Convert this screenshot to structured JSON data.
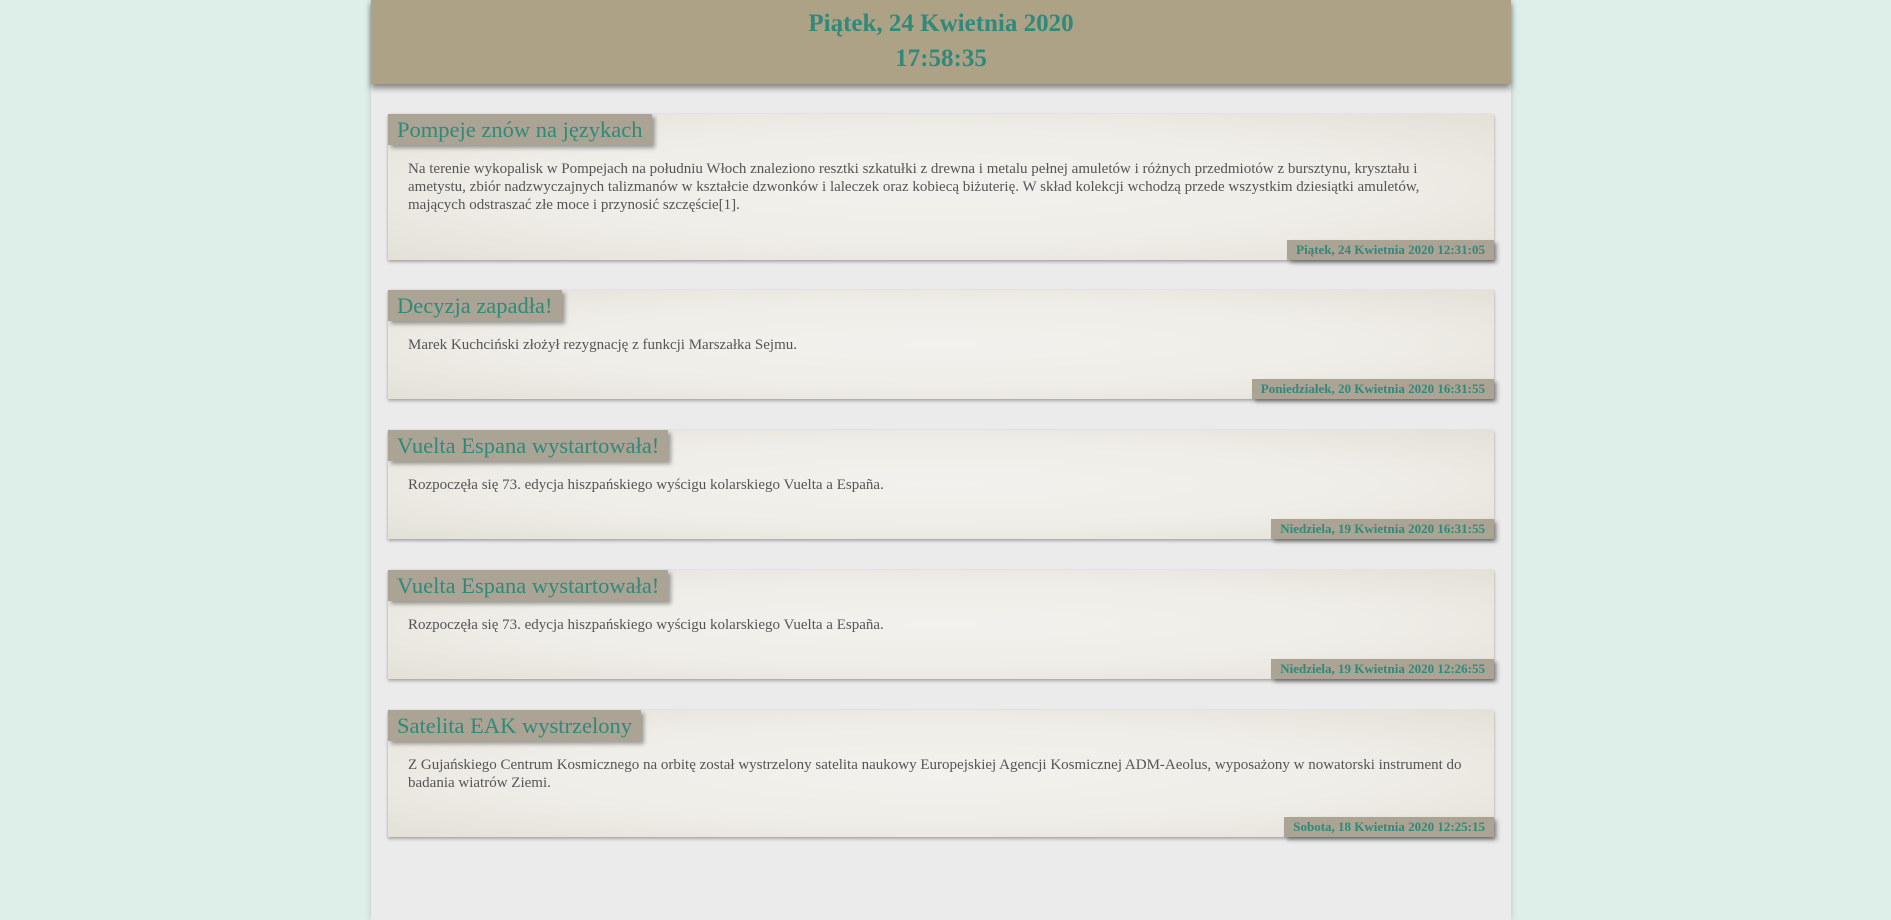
{
  "header": {
    "date": "Piątek, 24 Kwietnia 2020",
    "time": "17:58:35"
  },
  "news": [
    {
      "title": "Pompeje znów na językach",
      "body": "Na terenie wykopalisk w Pompejach na południu Włoch znaleziono resztki szkatułki z drewna i metalu pełnej amuletów i różnych przedmiotów z bursztynu, kryształu i ametystu, zbiór nadzwyczajnych talizmanów w kształcie dzwonków i laleczek oraz kobiecą biżuterię. W skład kolekcji wchodzą przede wszystkim dziesiątki amuletów, mających odstraszać złe moce i przynosić szczęście[1].",
      "date": "Piątek, 24 Kwietnia 2020 12:31:05"
    },
    {
      "title": "Decyzja zapadła!",
      "body": "Marek Kuchciński złożył rezygnację z funkcji Marszałka Sejmu.",
      "date": "Poniedziałek, 20 Kwietnia 2020 16:31:55"
    },
    {
      "title": "Vuelta Espana wystartowała!",
      "body": "Rozpoczęła się 73. edycja hiszpańskiego wyścigu kolarskiego Vuelta a España.",
      "date": "Niedziela, 19 Kwietnia 2020 16:31:55"
    },
    {
      "title": "Vuelta Espana wystartowała!",
      "body": "Rozpoczęła się 73. edycja hiszpańskiego wyścigu kolarskiego Vuelta a España.",
      "date": "Niedziela, 19 Kwietnia 2020 12:26:55"
    },
    {
      "title": "Satelita EAK wystrzelony",
      "body": "Z Gujańskiego Centrum Kosmicznego na orbitę został wystrzelony satelita naukowy Europejskiej Agencji Kosmicznej ADM-Aeolus, wyposażony w nowatorski instrument do badania wiatrów Ziemi.",
      "date": "Sobota, 18 Kwietnia 2020 12:25:15"
    }
  ],
  "colors": {
    "background": "#deefe9",
    "header": "#ada286",
    "accent_text": "#2f8a7b",
    "label_bg": "#aba393",
    "body_text": "#555555"
  }
}
